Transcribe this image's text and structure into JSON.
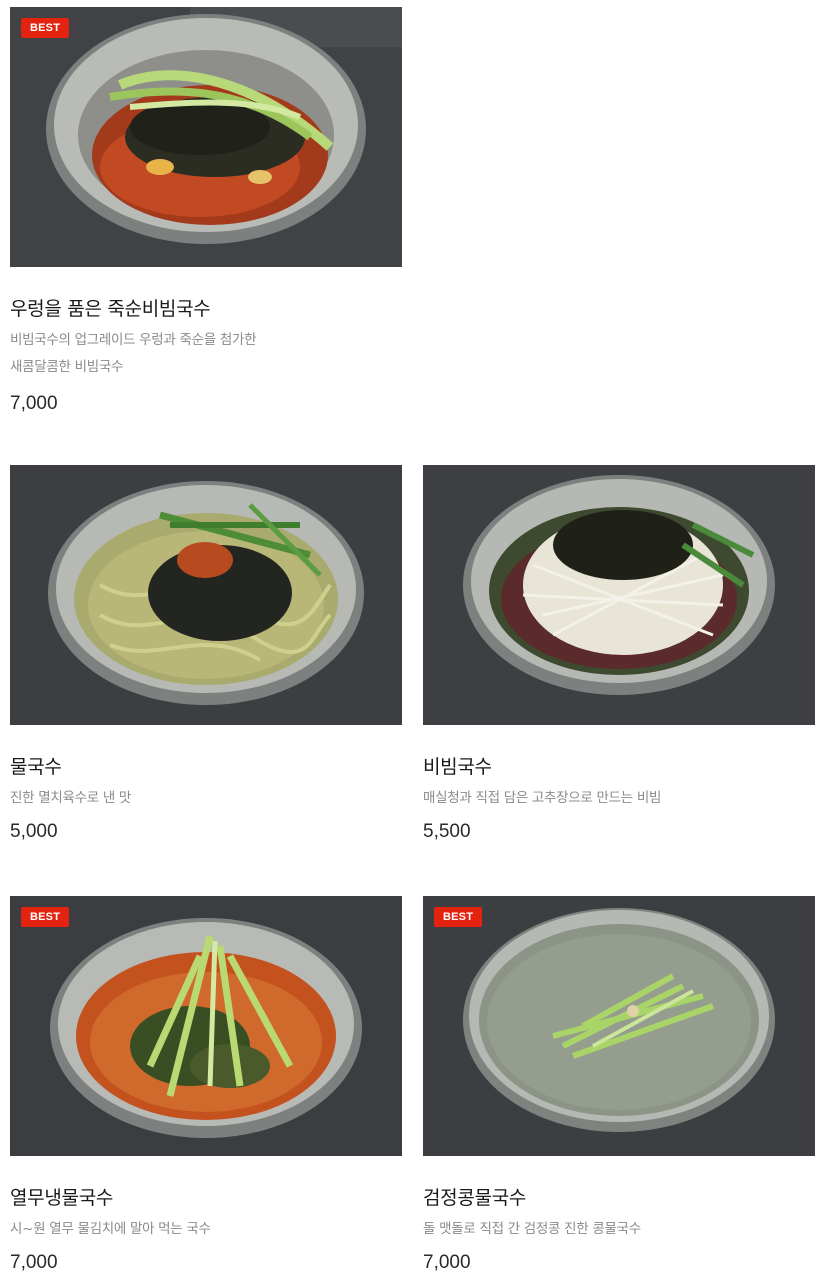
{
  "menu": {
    "items": [
      {
        "badge": "BEST",
        "name": "우렁을 품은 죽순비빔국수",
        "desc_lines": [
          "비빔국수의 업그레이드 우렁과 죽순을 첨가한",
          "새콤달콤한 비빔국수"
        ],
        "price": "7,000"
      },
      {
        "badge": "",
        "name": "물국수",
        "desc_lines": [
          "진한 멸치육수로 낸 맛"
        ],
        "price": "5,000"
      },
      {
        "badge": "",
        "name": "비빔국수",
        "desc_lines": [
          "매실청과 직접 담은 고추장으로 만드는 비빔"
        ],
        "price": "5,500"
      },
      {
        "badge": "BEST",
        "name": "열무냉물국수",
        "desc_lines": [
          "시~원 열무 물김치에 말아 먹는 국수"
        ],
        "price": "7,000"
      },
      {
        "badge": "BEST",
        "name": "검정콩물국수",
        "desc_lines": [
          "돌 맷돌로 직접 간 검정콩 진한 콩물국수"
        ],
        "price": "7,000"
      }
    ]
  },
  "colors": {
    "badge": "#e3230f",
    "table_surface": "#3b3d40",
    "bowl_metal": "#b9bbb7"
  },
  "images": [
    "bibim-noodle-with-seaweed-and-cucumber-photo",
    "mul-noodle-in-broth-photo",
    "bibim-noodle-with-cabbage-photo",
    "yeolmu-cold-noodle-photo",
    "black-bean-noodle-soup-photo"
  ]
}
